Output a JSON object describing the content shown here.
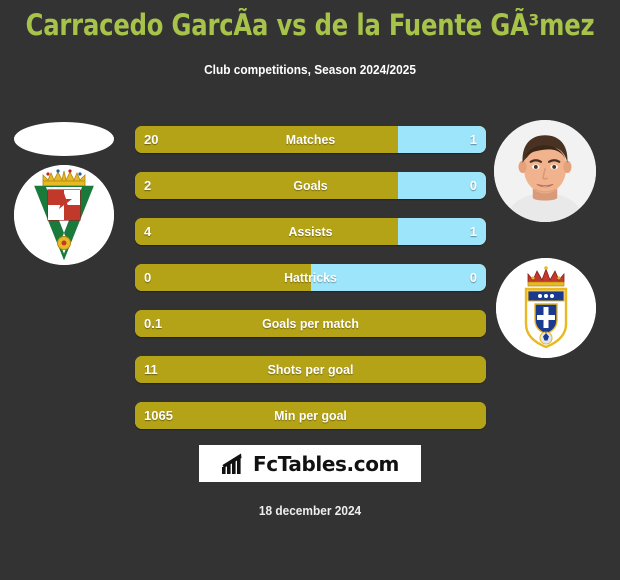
{
  "header": {
    "title": "Carracedo GarcÃ­a vs de la Fuente GÃ³mez",
    "subtitle": "Club competitions, Season 2024/2025"
  },
  "colors": {
    "background": "#333333",
    "title_green": "#a8c34a",
    "bar_gold": "#b5a317",
    "bar_blue": "#9ce5fb",
    "logo_background": "#ffffff",
    "text_white": "#ffffff"
  },
  "media": {
    "left_photo_placeholder": "player-photo-placeholder",
    "left_crest": "cordoba-cf-crest",
    "right_photo": "player-photo",
    "right_crest": "real-oviedo-crest"
  },
  "chart_data": {
    "type": "bar",
    "title": "Carracedo GarcÃ­a vs de la Fuente GÃ³mez",
    "subtitle": "Club competitions, Season 2024/2025",
    "comparison": "two-sided horizontal bars",
    "categories": [
      "Matches",
      "Goals",
      "Assists",
      "Hattricks",
      "Goals per match",
      "Shots per goal",
      "Min per goal"
    ],
    "series": [
      {
        "name": "Carracedo GarcÃ­a",
        "color": "#b5a317",
        "values": [
          "20",
          "2",
          "4",
          "0",
          "0.1",
          "11",
          "1065"
        ]
      },
      {
        "name": "de la Fuente GÃ³mez",
        "color": "#9ce5fb",
        "values": [
          "1",
          "0",
          "1",
          "0",
          null,
          null,
          null
        ]
      }
    ],
    "left_fill_percent": [
      75,
      75,
      75,
      50,
      100,
      100,
      100
    ],
    "legend_position": "none",
    "grid": false
  },
  "rows": [
    {
      "label": "Matches",
      "left": "20",
      "right": "1",
      "left_pct": 75,
      "two_sided": true
    },
    {
      "label": "Goals",
      "left": "2",
      "right": "0",
      "left_pct": 75,
      "two_sided": true
    },
    {
      "label": "Assists",
      "left": "4",
      "right": "1",
      "left_pct": 75,
      "two_sided": true
    },
    {
      "label": "Hattricks",
      "left": "0",
      "right": "0",
      "left_pct": 50,
      "two_sided": true
    },
    {
      "label": "Goals per match",
      "left": "0.1",
      "right": "",
      "left_pct": 100,
      "two_sided": false
    },
    {
      "label": "Shots per goal",
      "left": "11",
      "right": "",
      "left_pct": 100,
      "two_sided": false
    },
    {
      "label": "Min per goal",
      "left": "1065",
      "right": "",
      "left_pct": 100,
      "two_sided": false
    }
  ],
  "footer": {
    "brand": "FcTables.com",
    "brand_icon": "bar-chart-icon",
    "date": "18 december 2024"
  }
}
